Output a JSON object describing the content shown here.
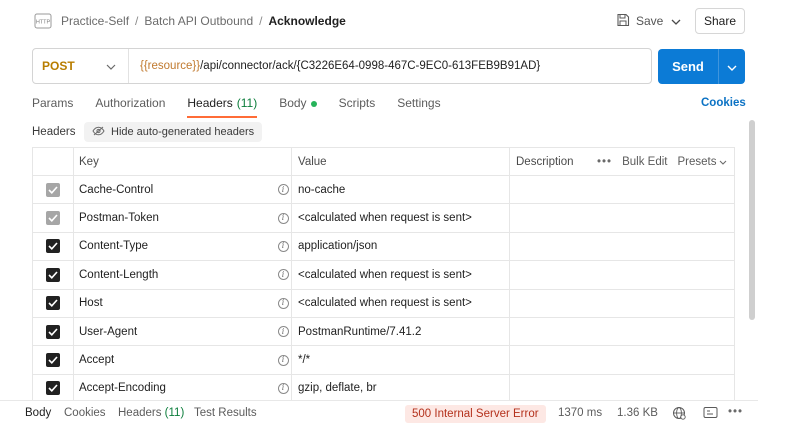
{
  "breadcrumb": {
    "workspace": "Practice-Self",
    "collection": "Batch API Outbound",
    "request": "Acknowledge"
  },
  "toolbar": {
    "save_label": "Save",
    "share_label": "Share"
  },
  "request": {
    "method": "POST",
    "url_variable": "{{resource}}",
    "url_path": "/api/connector/ack/{C3226E64-0998-467C-9EC0-613FEB9B91AD}",
    "send_label": "Send"
  },
  "tabs": [
    {
      "label": "Params"
    },
    {
      "label": "Authorization"
    },
    {
      "label": "Headers",
      "count": "(11)"
    },
    {
      "label": "Body"
    },
    {
      "label": "Scripts"
    },
    {
      "label": "Settings"
    }
  ],
  "cookies_link": "Cookies",
  "headers_panel": {
    "label": "Headers",
    "hide_auto_label": "Hide auto-generated headers"
  },
  "table": {
    "columns": {
      "key": "Key",
      "value": "Value",
      "description": "Description"
    },
    "bulk_edit": "Bulk Edit",
    "presets": "Presets",
    "rows": [
      {
        "key": "Cache-Control",
        "value": "no-cache",
        "state": "disabled"
      },
      {
        "key": "Postman-Token",
        "value": "<calculated when request is sent>",
        "state": "disabled"
      },
      {
        "key": "Content-Type",
        "value": "application/json",
        "state": "on"
      },
      {
        "key": "Content-Length",
        "value": "<calculated when request is sent>",
        "state": "on"
      },
      {
        "key": "Host",
        "value": "<calculated when request is sent>",
        "state": "on"
      },
      {
        "key": "User-Agent",
        "value": "PostmanRuntime/7.41.2",
        "state": "on"
      },
      {
        "key": "Accept",
        "value": "*/*",
        "state": "on"
      },
      {
        "key": "Accept-Encoding",
        "value": "gzip, deflate, br",
        "state": "on"
      }
    ]
  },
  "response": {
    "tabs": [
      {
        "label": "Body"
      },
      {
        "label": "Cookies"
      },
      {
        "label": "Headers",
        "count": "(11)"
      },
      {
        "label": "Test Results"
      }
    ],
    "status": "500 Internal Server Error",
    "time": "1370 ms",
    "size": "1.36 KB"
  },
  "colors": {
    "method_post": "#b87d00",
    "send": "#0c7bd6",
    "active_tab_underline": "#ff6c37",
    "error_badge_bg": "#fde8e4",
    "error_badge_text": "#b4311c"
  }
}
